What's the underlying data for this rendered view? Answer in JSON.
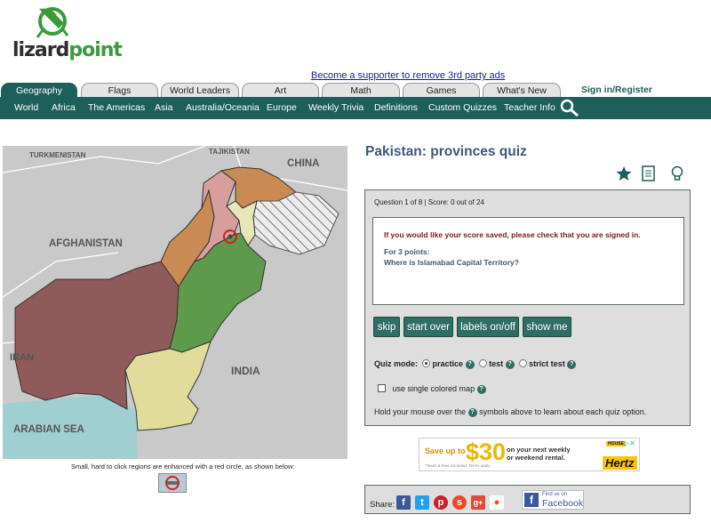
{
  "header": {
    "logo_a": "lizard",
    "logo_b": "point",
    "supporter_link": "Become a supporter to remove 3rd party ads",
    "signin": "Sign in/Register"
  },
  "tabs": [
    "Geography",
    "Flags",
    "World Leaders",
    "Art",
    "Math",
    "Games",
    "What's New"
  ],
  "nav": [
    "World",
    "Africa",
    "The Americas",
    "Asia",
    "Australia/Oceania",
    "Europe",
    "Weekly Trivia",
    "Definitions",
    "Custom Quizzes",
    "Teacher Info"
  ],
  "map": {
    "labels": {
      "turkmenistan": "TURKMENISTAN",
      "tajikistan": "TAJIKISTAN",
      "china": "CHINA",
      "afghanistan": "AFGHANISTAN",
      "iran": "IRAN",
      "india": "INDIA",
      "sea": "ARABIAN SEA"
    },
    "colors": {
      "land": "#c9c9c9",
      "sea": "#9fcfd0",
      "balochistan": "#8e5a5a",
      "punjab": "#5e9a4c",
      "sindh": "#e2dc9c",
      "kpk": "#d79e9e",
      "fata": "#c98a53",
      "gb": "#c98a53",
      "ajk": "#e8e6b8",
      "disputed": "#ececec"
    },
    "caption": "Small, hard to click regions are enhanced with a red circle, as shown below:"
  },
  "quiz": {
    "title": "Pakistan: provinces quiz",
    "progress": "Question 1 of 8 | Score: 0 out of 24",
    "warning": "If you would like your score saved, please check that you are signed in.",
    "points": "For 3 points:",
    "question": "Where is Islamabad Capital Territory?",
    "buttons": [
      "skip",
      "start over",
      "labels on/off",
      "show me"
    ],
    "mode_label": "Quiz mode:",
    "modes": [
      "practice",
      "test",
      "strict test"
    ],
    "selected_mode": "practice",
    "single_color": "use single colored map",
    "hint_a": "Hold your mouse over the",
    "hint_b": "symbols above to learn about each quiz option.",
    "qmark": "?"
  },
  "ad": {
    "save": "Save up to",
    "amount": "$30",
    "line1": "on your next weekly",
    "line2": "or weekend rental.",
    "fine": "*Taxes & fees excluded. Terms apply.",
    "brand": "Hertz",
    "tag": "HOUSE"
  },
  "share": {
    "label": "Share:",
    "find_us": "Find us on",
    "facebook": "Facebook"
  }
}
